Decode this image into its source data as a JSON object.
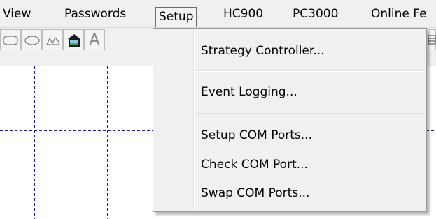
{
  "menubar": {
    "items": [
      {
        "label": "View"
      },
      {
        "label": "Passwords"
      },
      {
        "label": "Setup"
      },
      {
        "label": "HC900"
      },
      {
        "label": "PC3000"
      },
      {
        "label": "Online Fe"
      }
    ],
    "active": "Setup"
  },
  "toolbar": {
    "tools": [
      {
        "icon": "rounded-rectangle-icon"
      },
      {
        "icon": "ellipse-icon"
      },
      {
        "icon": "freeform-line-icon"
      },
      {
        "icon": "bitmap-image-icon"
      },
      {
        "icon": "text-tool-icon",
        "glyph": "A"
      }
    ]
  },
  "setup_menu": {
    "groups": [
      [
        "Strategy Controller..."
      ],
      [
        "Event Logging..."
      ],
      [
        "Setup COM Ports...",
        "Check COM Port...",
        "Swap COM Ports..."
      ]
    ]
  },
  "colors": {
    "chrome": "#f0f0f0",
    "grid": "#1a1acc",
    "menu_border": "#9a9a9a"
  }
}
